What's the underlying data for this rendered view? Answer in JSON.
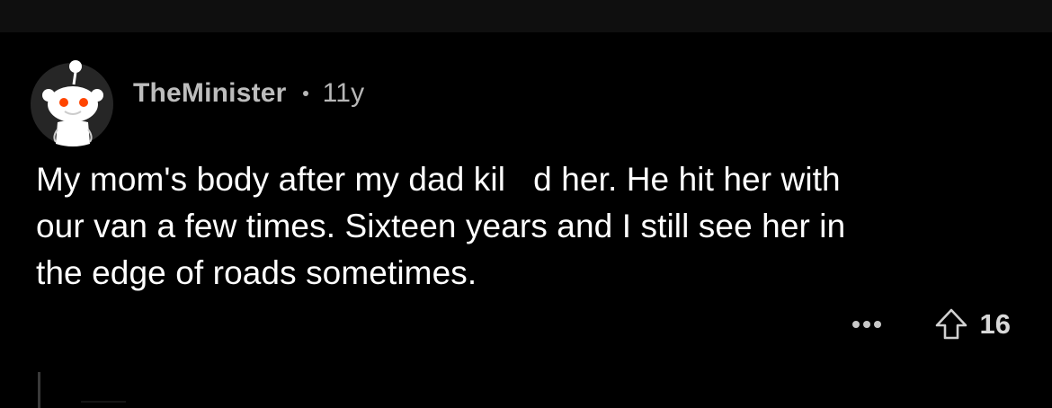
{
  "comment": {
    "author": "TheMinister",
    "age": "11y",
    "body_lines": [
      "My mom's body after my dad kil   d her. He hit her with",
      "our van a few times. Sixteen years and I still see her in",
      "the edge of roads sometimes."
    ],
    "score": "16"
  },
  "icons": {
    "avatar": "reddit-snoo-avatar",
    "more": "ellipsis-icon",
    "upvote": "upvote-arrow-icon"
  },
  "colors": {
    "background": "#000000",
    "top_bar": "#0f0f0f",
    "meta_text": "#b7b7b7",
    "body_text": "#ffffff",
    "snoo_eye": "#ff4500"
  }
}
